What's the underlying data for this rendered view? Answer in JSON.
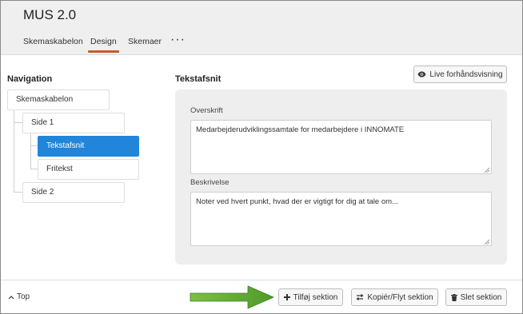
{
  "app": {
    "title": "MUS 2.0"
  },
  "tabs": [
    {
      "label": "Skemaskabelon",
      "active": false
    },
    {
      "label": "Design",
      "active": true
    },
    {
      "label": "Skemaer",
      "active": false
    }
  ],
  "more_menu_label": "···",
  "navigation": {
    "heading": "Navigation",
    "nodes": [
      {
        "label": "Skemaskabelon"
      },
      {
        "label": "Side 1"
      },
      {
        "label": "Tekstafsnit",
        "selected": true
      },
      {
        "label": "Fritekst"
      },
      {
        "label": "Side 2"
      }
    ]
  },
  "editor": {
    "heading": "Tekstafsnit",
    "preview_button": "Live forhåndsvisning",
    "fields": [
      {
        "label": "Overskrift",
        "value": "Medarbejderudviklingssamtale for medarbejdere i INNOMATE"
      },
      {
        "label": "Beskrivelse",
        "value": "Noter ved hvert punkt, hvad der er vigtigt for dig at tale om..."
      }
    ]
  },
  "footer": {
    "top_link": "Top",
    "buttons": [
      {
        "label": "Tilføj sektion",
        "icon": "plus-icon"
      },
      {
        "label": "Kopiér/Flyt sektion",
        "icon": "swap-arrows-icon"
      },
      {
        "label": "Slet sektion",
        "icon": "trash-icon"
      }
    ]
  },
  "colors": {
    "accent_tab": "#c0612b",
    "selected_node": "#2185d9",
    "annotation_arrow": "#5a9e2f"
  }
}
